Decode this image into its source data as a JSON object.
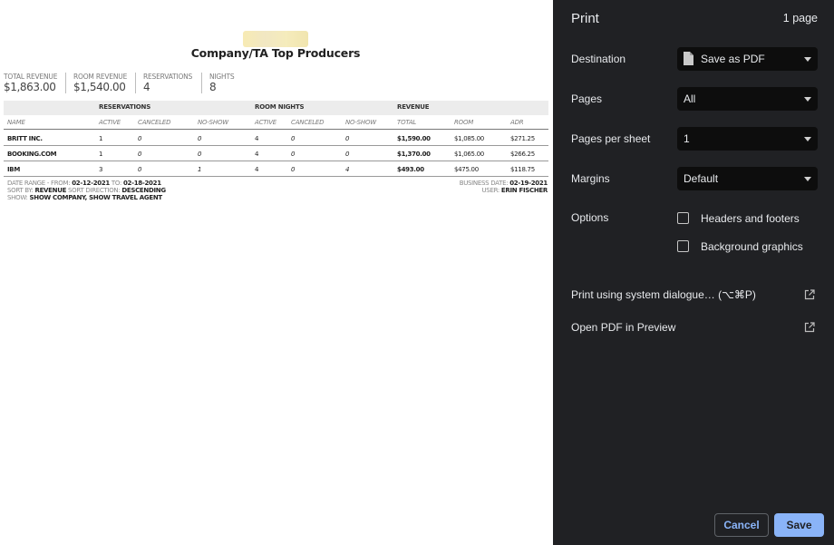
{
  "report": {
    "title": "Company/TA Top Producers",
    "kpis": [
      {
        "label": "Total Revenue",
        "value": "$1,863.00"
      },
      {
        "label": "Room Revenue",
        "value": "$1,540.00"
      },
      {
        "label": "Reservations",
        "value": "4"
      },
      {
        "label": "Nights",
        "value": "8"
      }
    ],
    "groups": {
      "reservations": "RESERVATIONS",
      "room_nights": "ROOM NIGHTS",
      "revenue": "REVENUE"
    },
    "columns": [
      "Name",
      "Active",
      "Canceled",
      "No-Show",
      "Active",
      "Canceled",
      "No-Show",
      "Total",
      "Room",
      "ADR"
    ],
    "rows": [
      [
        "BRITT INC.",
        "1",
        "0",
        "0",
        "4",
        "0",
        "0",
        "$1,590.00",
        "$1,085.00",
        "$271.25"
      ],
      [
        "BOOKING.COM",
        "1",
        "0",
        "0",
        "4",
        "0",
        "0",
        "$1,370.00",
        "$1,065.00",
        "$266.25"
      ],
      [
        "IBM",
        "3",
        "0",
        "1",
        "4",
        "0",
        "4",
        "$493.00",
        "$475.00",
        "$118.75"
      ]
    ],
    "footer": {
      "date_range_label": "DATE RANGE - FROM:",
      "date_from": "02-12-2021",
      "to_label": "TO:",
      "date_to": "02-18-2021",
      "sort_by_label": "SORT BY:",
      "sort_by": "REVENUE",
      "sort_dir_label": "SORT DIRECTION:",
      "sort_dir": "DESCENDING",
      "show_label": "SHOW:",
      "show": "SHOW COMPANY, SHOW TRAVEL AGENT",
      "business_date_label": "BUSINESS DATE:",
      "business_date": "02-19-2021",
      "user_label": "USER:",
      "user": "ERIN FISCHER"
    }
  },
  "print_panel": {
    "title": "Print",
    "page_count": "1 page",
    "destination": {
      "label": "Destination",
      "value": "Save as PDF",
      "icon": "document-icon"
    },
    "pages": {
      "label": "Pages",
      "value": "All"
    },
    "pages_per_sheet": {
      "label": "Pages per sheet",
      "value": "1"
    },
    "margins": {
      "label": "Margins",
      "value": "Default"
    },
    "options": {
      "label": "Options",
      "headers_footers": {
        "label": "Headers and footers",
        "checked": false
      },
      "background_graphics": {
        "label": "Background graphics",
        "checked": false
      }
    },
    "system_dialog": {
      "label": "Print using system dialogue… (⌥⌘P)",
      "icon": "open-external-icon"
    },
    "open_preview": {
      "label": "Open PDF in Preview",
      "icon": "open-external-icon"
    },
    "cancel_label": "Cancel",
    "save_label": "Save"
  },
  "colors": {
    "panel_bg": "#202124",
    "select_bg": "#0d0d0d",
    "accent": "#8ab4f8"
  }
}
